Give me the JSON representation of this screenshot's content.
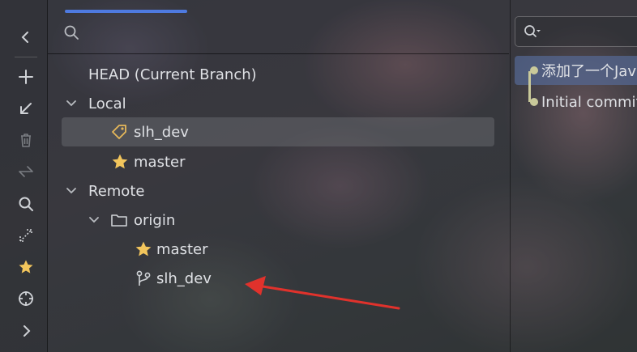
{
  "tree": {
    "head_label": "HEAD (Current Branch)",
    "local_label": "Local",
    "local_branches": [
      "slh_dev",
      "master"
    ],
    "remote_label": "Remote",
    "remote_name": "origin",
    "remote_branches": [
      "master",
      "slh_dev"
    ]
  },
  "commits": [
    "添加了一个Jav",
    "Initial commit"
  ],
  "colors": {
    "accent": "#4e7ae0",
    "favorite_star": "#f2c55c",
    "graph_line": "#c9c99a",
    "selected_commit": "#55699a",
    "annotation_arrow": "#e0322c"
  },
  "icons": {
    "toolbar": [
      "chevron-left-icon",
      "plus-icon",
      "checkout-arrow-icon",
      "trash-icon",
      "merge-arrows-icon",
      "search-icon",
      "compare-icon",
      "star-icon",
      "locate-icon",
      "chevron-right-icon"
    ]
  }
}
